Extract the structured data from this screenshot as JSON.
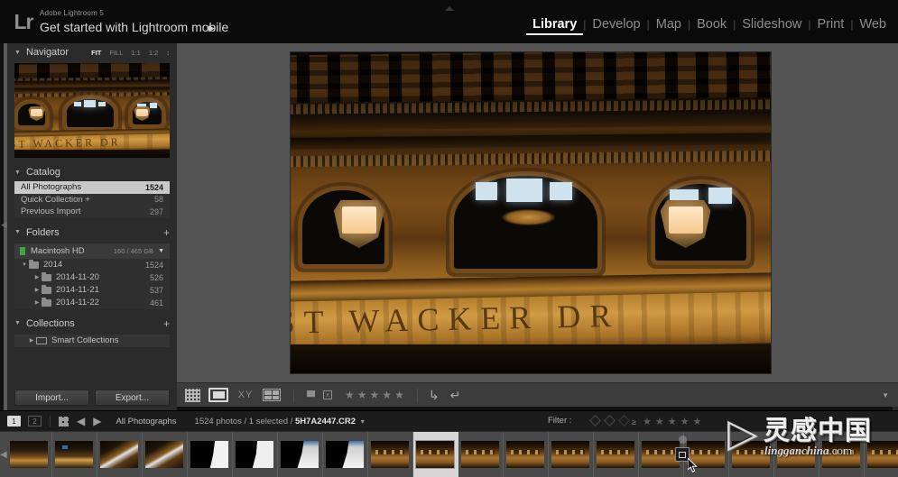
{
  "app": {
    "vendor_line": "Adobe Lightroom 5",
    "headline": "Get started with Lightroom mobile",
    "headline_arrow": "▶",
    "logo": "Lr"
  },
  "modules": [
    {
      "label": "Library",
      "active": true
    },
    {
      "label": "Develop",
      "active": false
    },
    {
      "label": "Map",
      "active": false
    },
    {
      "label": "Book",
      "active": false
    },
    {
      "label": "Slideshow",
      "active": false
    },
    {
      "label": "Print",
      "active": false
    },
    {
      "label": "Web",
      "active": false
    }
  ],
  "module_separator": "|",
  "navigator": {
    "title": "Navigator",
    "collapse_triangle": "▼",
    "modes": [
      {
        "label": "FIT",
        "active": true
      },
      {
        "label": "FILL",
        "active": false
      },
      {
        "label": "1:1",
        "active": false
      },
      {
        "label": "1:2",
        "active": false
      }
    ],
    "mode_caret": "↕"
  },
  "catalog": {
    "title": "Catalog",
    "collapse_triangle": "▼",
    "items": [
      {
        "label": "All Photographs",
        "count": "1524",
        "selected": true
      },
      {
        "label": "Quick Collection  +",
        "count": "58",
        "selected": false
      },
      {
        "label": "Previous Import",
        "count": "297",
        "selected": false
      }
    ]
  },
  "folders": {
    "title": "Folders",
    "collapse_triangle": "▼",
    "add_label": "+",
    "volume": {
      "name": "Macintosh HD",
      "space": "160 / 465 GB",
      "caret": "▼"
    },
    "tree": [
      {
        "label": "2014",
        "count": "1524",
        "depth": 0,
        "disclosure": "▼"
      },
      {
        "label": "2014-11-20",
        "count": "526",
        "depth": 1,
        "disclosure": "▶"
      },
      {
        "label": "2014-11-21",
        "count": "537",
        "depth": 1,
        "disclosure": "▶"
      },
      {
        "label": "2014-11-22",
        "count": "461",
        "depth": 1,
        "disclosure": "▶"
      }
    ]
  },
  "collections": {
    "title": "Collections",
    "collapse_triangle": "▼",
    "add_label": "+",
    "items": [
      {
        "label": "Smart Collections",
        "disclosure": "▶"
      }
    ]
  },
  "left_buttons": {
    "import": "Import...",
    "export": "Export..."
  },
  "toolbar": {
    "view_modes": [
      "grid-view-icon",
      "loupe-view-icon",
      "compare-view-icon",
      "survey-view-icon"
    ],
    "compare_label": "XY",
    "flag_pick": "flag-pick-icon",
    "flag_reject": "x",
    "stars": [
      "★",
      "★",
      "★",
      "★",
      "★"
    ],
    "rotate_left": "↳",
    "rotate_right": "↵",
    "caret": "▼"
  },
  "filmstrip_bar": {
    "screen1": "1",
    "screen2": "2",
    "back_arrow": "◀",
    "forward_arrow": "▶",
    "source": "All Photographs",
    "photo_count": "1524 photos",
    "separator1": "/",
    "selected_count": "1 selected",
    "separator2": "/",
    "filename": "5H7A2447.CR2",
    "filename_caret": "▾",
    "filter_label": "Filter :",
    "filter_operator": "≥",
    "filter_stars": [
      "★",
      "★",
      "★",
      "★",
      "★"
    ]
  },
  "filmstrip": {
    "left_arrow": "◀",
    "thumbnails": [
      {
        "kind": "t-street",
        "selected": false
      },
      {
        "kind": "t-street2",
        "selected": false
      },
      {
        "kind": "t-diag",
        "selected": false
      },
      {
        "kind": "t-diag",
        "selected": false
      },
      {
        "kind": "t-sil",
        "selected": false
      },
      {
        "kind": "t-sil2",
        "selected": false
      },
      {
        "kind": "t-silc",
        "selected": false
      },
      {
        "kind": "t-silc",
        "selected": false
      },
      {
        "kind": "t-bld",
        "selected": false
      },
      {
        "kind": "t-bld",
        "selected": true
      },
      {
        "kind": "t-bld",
        "selected": false
      },
      {
        "kind": "t-bld",
        "selected": false
      },
      {
        "kind": "t-bld",
        "selected": false
      },
      {
        "kind": "t-bld",
        "selected": false
      },
      {
        "kind": "t-bld",
        "selected": false
      },
      {
        "kind": "t-bld",
        "selected": false
      },
      {
        "kind": "t-bld",
        "selected": false
      },
      {
        "kind": "t-bld",
        "selected": false
      },
      {
        "kind": "t-bld",
        "selected": false
      },
      {
        "kind": "t-bld",
        "selected": false
      }
    ]
  },
  "photo": {
    "inscription": "ST WACKER DR",
    "description": "Night photograph of an illuminated classical building facade with arched windows and lanterns"
  },
  "watermark": {
    "mark": "▷",
    "chinese": "灵感中国",
    "domain_name": "lingganchina",
    "domain_tld": ".com"
  },
  "edges": {
    "left_collapse": "◀",
    "right_collapse": "▶"
  },
  "colors": {
    "panel_bg": "#2b2b2b",
    "canvas_bg": "#545454",
    "toolbar_bg": "#3c3c3c",
    "filmstrip_bg": "#494949",
    "accent_text": "#ffffff",
    "selection": "#c9c9c9"
  }
}
